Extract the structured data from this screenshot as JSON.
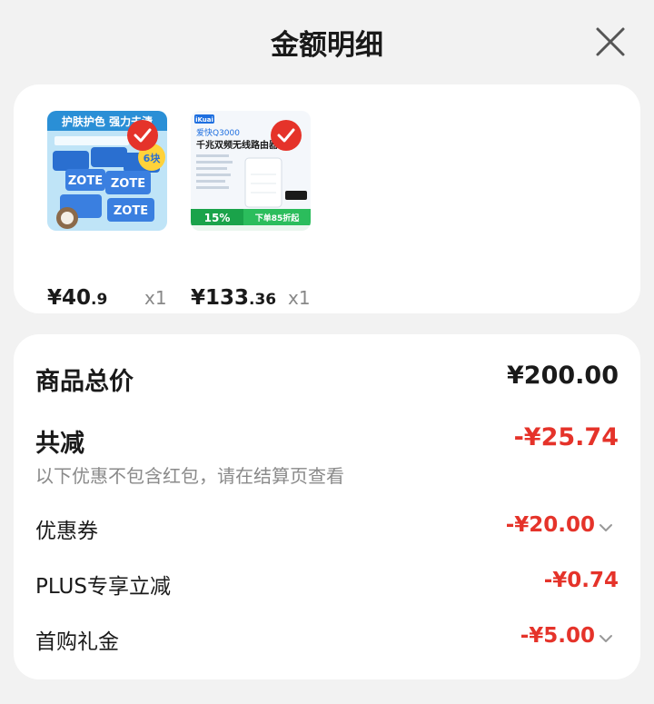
{
  "header": {
    "title": "金额明细"
  },
  "products": [
    {
      "price_main": "¥40",
      "price_cents": ".9",
      "qty": "x1",
      "thumb_headline": "护肤护色 强力去渍",
      "thumb_badge": "6块",
      "thumb_brand": "ZOTE"
    },
    {
      "price_main": "¥133",
      "price_cents": ".36",
      "qty": "x1",
      "thumb_brand": "iKuai",
      "thumb_model": "爱快Q3000",
      "thumb_title": "千兆双频无线路由器",
      "thumb_discount": "15%",
      "thumb_promo": "下单85折起"
    }
  ],
  "summary": {
    "total_label": "商品总价",
    "total_value": "¥200.00",
    "reduce_label": "共减",
    "reduce_value": "-¥25.74",
    "note": "以下优惠不包含红包，请在结算页查看",
    "items": [
      {
        "label": "优惠券",
        "value": "-¥20.00"
      },
      {
        "label": "PLUS专享立减",
        "value": "-¥0.74"
      },
      {
        "label": "首购礼金",
        "value": "-¥5.00"
      }
    ]
  },
  "colors": {
    "accent_red": "#e5332a",
    "page_bg": "#f2f2f2",
    "card_bg": "#ffffff"
  }
}
